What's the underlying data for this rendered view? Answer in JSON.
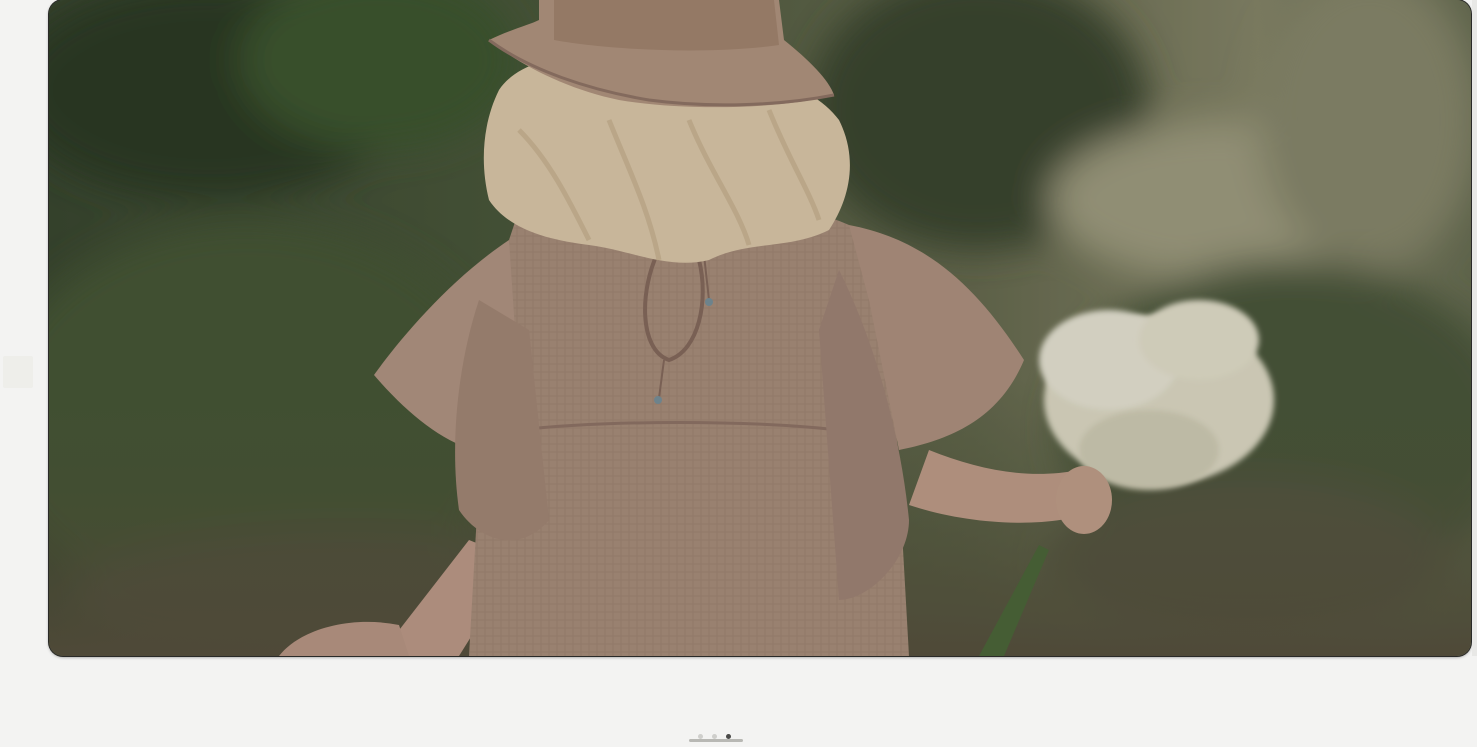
{
  "carousel": {
    "slides": [
      {
        "subject": "child-in-hat-and-dress-holding-flowers"
      }
    ],
    "pager": {
      "count": 3,
      "active_index": 2
    }
  },
  "colors": {
    "page_background": "#f3f3f2",
    "dress": "#b09482",
    "hat": "#b89a84",
    "foliage": "#56604a",
    "hair": "#e6d4b8",
    "flowers": "#ece8d6",
    "dot_active": "#4a4a48",
    "dot_inactive": "#cfcfcc"
  }
}
